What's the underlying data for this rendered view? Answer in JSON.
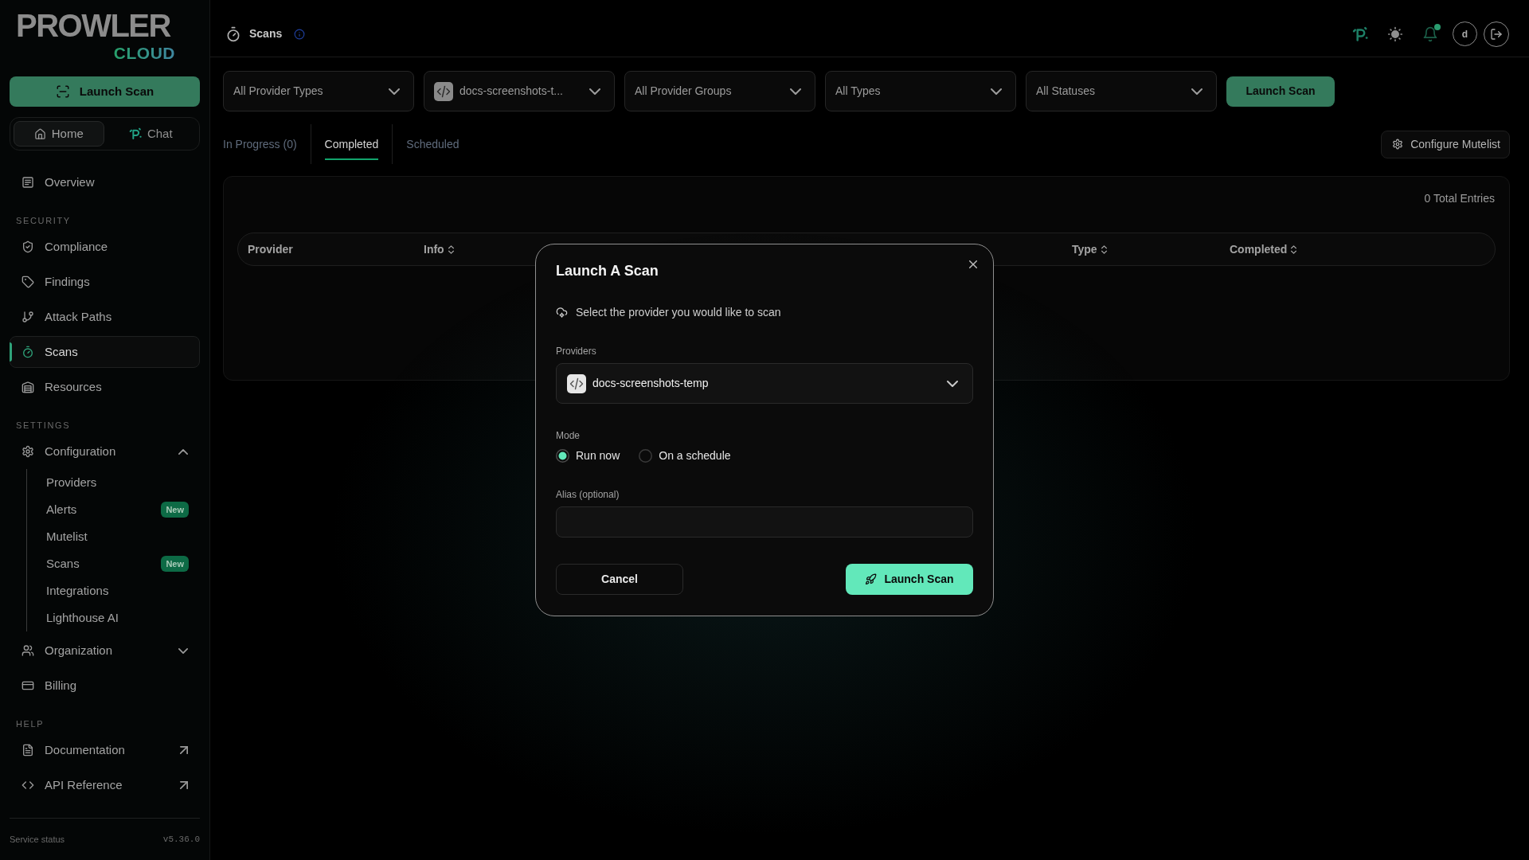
{
  "sidebar": {
    "logo": {
      "wordmark": "PROWLER",
      "tagline": "CLOUD"
    },
    "launch_button": "Launch Scan",
    "views": [
      {
        "label": "Home",
        "selected": true
      },
      {
        "label": "Chat",
        "selected": false
      }
    ],
    "sections": [
      {
        "items": [
          {
            "kind": "link",
            "label": "Overview",
            "selected": false
          }
        ]
      },
      {
        "heading": "SECURITY",
        "items": [
          {
            "kind": "link",
            "label": "Compliance",
            "selected": false
          },
          {
            "kind": "link",
            "label": "Findings",
            "selected": false
          },
          {
            "kind": "link",
            "label": "Attack Paths",
            "selected": false
          },
          {
            "kind": "link",
            "label": "Scans",
            "selected": true
          },
          {
            "kind": "link",
            "label": "Resources",
            "selected": false
          }
        ]
      },
      {
        "heading": "SETTINGS",
        "items": [
          {
            "kind": "group",
            "label": "Configuration",
            "selected": false,
            "expanded": true,
            "children": [
              {
                "label": "Providers",
                "selected": false
              },
              {
                "label": "Alerts",
                "selected": false,
                "badge": "New"
              },
              {
                "label": "Mutelist",
                "selected": false
              },
              {
                "label": "Scans",
                "selected": false,
                "badge": "New"
              },
              {
                "label": "Integrations",
                "selected": false
              },
              {
                "label": "Lighthouse AI",
                "selected": false
              }
            ]
          },
          {
            "kind": "group",
            "label": "Organization",
            "selected": false,
            "expanded": false
          },
          {
            "kind": "link",
            "label": "Billing",
            "selected": false
          }
        ]
      },
      {
        "heading": "HELP",
        "items": [
          {
            "kind": "external",
            "label": "Documentation",
            "selected": false
          },
          {
            "kind": "external",
            "label": "API Reference",
            "selected": false
          }
        ]
      }
    ],
    "footer": {
      "status": "Service status",
      "version": "v5.36.0"
    }
  },
  "header": {
    "title": "Scans",
    "avatar": "d",
    "unread": true
  },
  "filters": [
    {
      "kind": "select",
      "label": "All Provider Types"
    },
    {
      "kind": "provider",
      "label": "docs-screenshots-t..."
    },
    {
      "kind": "select",
      "label": "All Provider Groups"
    },
    {
      "kind": "select",
      "label": "All Types"
    },
    {
      "kind": "select",
      "label": "All Statuses"
    }
  ],
  "launch_button": "Launch Scan",
  "tabs": [
    {
      "label": "In Progress (0)",
      "selected": false
    },
    {
      "label": "Completed",
      "selected": true
    },
    {
      "label": "Scheduled",
      "selected": false
    }
  ],
  "mutelist_button": "Configure Mutelist",
  "table": {
    "total": "0 Total Entries",
    "columns": [
      {
        "label": "Provider",
        "sortable": false
      },
      {
        "label": "Info",
        "sortable": true
      },
      {
        "label": "Type",
        "sortable": true
      },
      {
        "label": "Completed",
        "sortable": true
      }
    ]
  },
  "dialog": {
    "title": "Launch A Scan",
    "hint": "Select the provider you would like to scan",
    "provider": {
      "label": "Providers",
      "value": "docs-screenshots-temp"
    },
    "mode": {
      "label": "Mode",
      "options": [
        {
          "label": "Run now",
          "selected": true
        },
        {
          "label": "On a schedule",
          "selected": false
        }
      ]
    },
    "alias": {
      "label": "Alias (optional)"
    },
    "buttons": [
      {
        "kind": "secondary",
        "label": "Cancel"
      },
      {
        "kind": "primary",
        "label": "Launch Scan"
      }
    ]
  }
}
